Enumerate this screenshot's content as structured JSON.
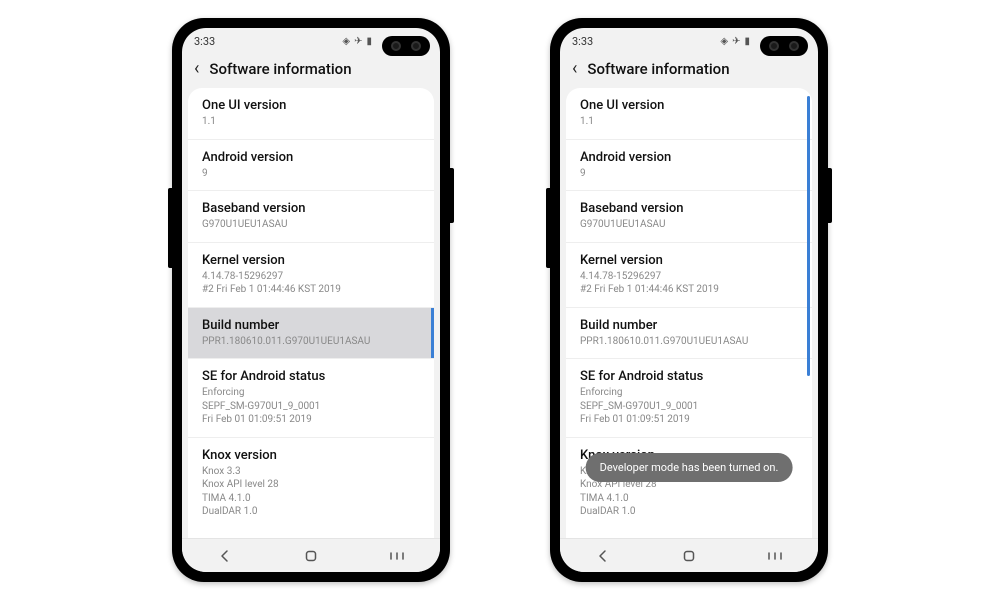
{
  "status": {
    "time": "3:33"
  },
  "header": {
    "title": "Software information"
  },
  "items": {
    "one_ui": {
      "title": "One UI version",
      "value": "1.1"
    },
    "android": {
      "title": "Android version",
      "value": "9"
    },
    "baseband": {
      "title": "Baseband version",
      "value": "G970U1UEU1ASAU"
    },
    "kernel": {
      "title": "Kernel version",
      "value": "4.14.78-15296297\n#2 Fri Feb 1 01:44:46 KST 2019"
    },
    "build": {
      "title": "Build number",
      "value": "PPR1.180610.011.G970U1UEU1ASAU"
    },
    "se": {
      "title": "SE for Android status",
      "value": "Enforcing\nSEPF_SM-G970U1_9_0001\nFri Feb 01 01:09:51 2019"
    },
    "knox": {
      "title": "Knox version",
      "value": "Knox 3.3\nKnox API level 28\nTIMA 4.1.0\nDualDAR 1.0"
    }
  },
  "toast": {
    "text": "Developer mode has been turned on."
  }
}
